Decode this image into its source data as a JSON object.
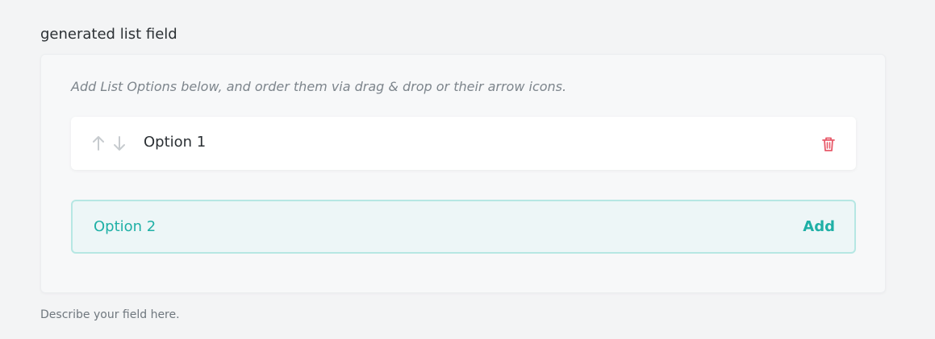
{
  "field": {
    "label": "generated list field",
    "description": "Describe your field here."
  },
  "panel": {
    "instructions": "Add List Options below, and order them via drag & drop or their arrow icons.",
    "options": [
      {
        "label": "Option 1"
      }
    ],
    "add_row": {
      "value": "Option 2",
      "add_label": "Add"
    }
  },
  "icons": {
    "move_up": "arrow-up-icon",
    "move_down": "arrow-down-icon",
    "delete": "trash-icon"
  },
  "colors": {
    "page_bg": "#f3f4f5",
    "panel_bg": "#f7f8f9",
    "accent": "#1fb0a6",
    "danger": "#e85a6a",
    "muted_icon": "#c7cbcf"
  }
}
